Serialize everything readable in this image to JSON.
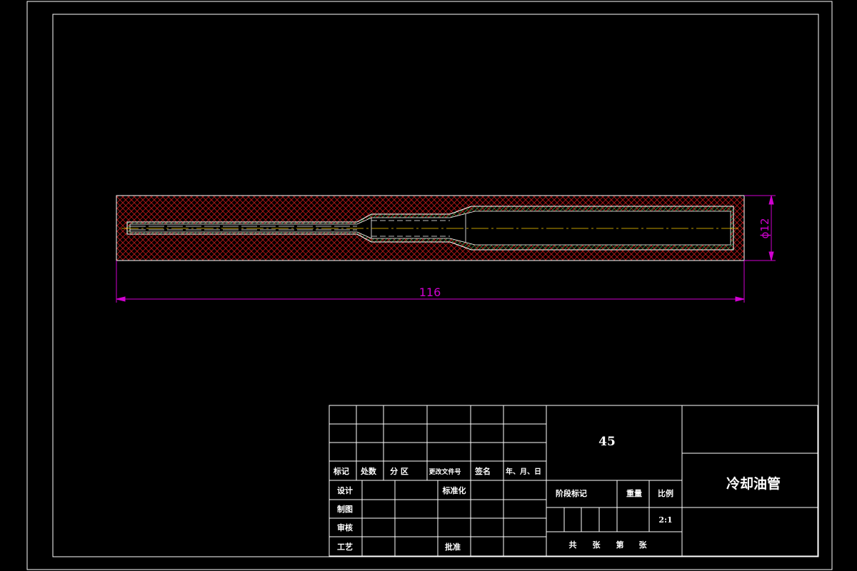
{
  "dimensions": {
    "length": "116",
    "diameter": "ϕ12"
  },
  "title_block": {
    "material": "45",
    "part_name": "冷却油管",
    "revision_headers": [
      "标记",
      "处数",
      "分 区",
      "更改文件号",
      "签名",
      "年、月、日"
    ],
    "sign_rows": [
      "设计",
      "制图",
      "审核",
      "工艺"
    ],
    "standardization": "标准化",
    "approval": "批准",
    "stage_mark": "阶段标记",
    "weight": "重量",
    "scale_label": "比例",
    "scale_value": "2:1",
    "sheets_total_label": "共",
    "sheets_unit_1": "张",
    "sheet_no_label": "第",
    "sheets_unit_2": "张"
  },
  "colors": {
    "background": "#000000",
    "frame": "#ffffff",
    "dimension": "#d000d0",
    "hatch_body": "#c01818",
    "hatch_inner": "#1f8a3a",
    "outline": "#ffffff",
    "center_line": "#ffd000"
  }
}
